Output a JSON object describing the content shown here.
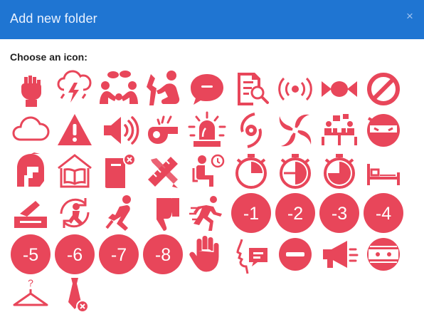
{
  "dialog": {
    "title": "Add new folder",
    "close_glyph": "×",
    "choose_label": "Choose an icon:"
  },
  "colors": {
    "header_bg": "#1f75d2",
    "icon_red": "#e8465a",
    "background": "#ffffff"
  },
  "icons": [
    {
      "name": "raised-fist-icon"
    },
    {
      "name": "thunderstorm-cloud-icon"
    },
    {
      "name": "people-talking-icon"
    },
    {
      "name": "person-kneeling-icon"
    },
    {
      "name": "speech-bubble-icon"
    },
    {
      "name": "document-search-icon"
    },
    {
      "name": "broadcast-signal-icon"
    },
    {
      "name": "candy-icon"
    },
    {
      "name": "no-entry-icon"
    },
    {
      "name": "cloud-icon"
    },
    {
      "name": "warning-triangle-icon"
    },
    {
      "name": "speaker-volume-icon"
    },
    {
      "name": "whistle-icon"
    },
    {
      "name": "siren-light-icon"
    },
    {
      "name": "hurricane-icon"
    },
    {
      "name": "tornado-spiral-icon"
    },
    {
      "name": "meeting-table-icon"
    },
    {
      "name": "ninja-icon"
    },
    {
      "name": "spartan-helmet-icon"
    },
    {
      "name": "reading-house-icon"
    },
    {
      "name": "book-remove-icon"
    },
    {
      "name": "ruler-pencil-icon"
    },
    {
      "name": "waiting-room-icon"
    },
    {
      "name": "stopwatch-quarter-icon"
    },
    {
      "name": "stopwatch-half-icon"
    },
    {
      "name": "stopwatch-three-quarter-icon"
    },
    {
      "name": "bed-icon"
    },
    {
      "name": "ballot-box-icon"
    },
    {
      "name": "rotate-person-icon"
    },
    {
      "name": "thinking-person-icon"
    },
    {
      "name": "thumbs-down-icon"
    },
    {
      "name": "running-person-icon"
    },
    {
      "name": "minus-one-icon",
      "text": "-1"
    },
    {
      "name": "minus-two-icon",
      "text": "-2"
    },
    {
      "name": "minus-three-icon",
      "text": "-3"
    },
    {
      "name": "minus-four-icon",
      "text": "-4"
    },
    {
      "name": "minus-five-icon",
      "text": "-5"
    },
    {
      "name": "minus-six-icon",
      "text": "-6"
    },
    {
      "name": "minus-seven-icon",
      "text": "-7"
    },
    {
      "name": "minus-eight-icon",
      "text": "-8"
    },
    {
      "name": "raised-hand-icon"
    },
    {
      "name": "talking-head-icon"
    },
    {
      "name": "minus-circle-icon"
    },
    {
      "name": "megaphone-icon"
    },
    {
      "name": "mummy-face-icon"
    },
    {
      "name": "hanger-question-icon"
    },
    {
      "name": "tie-remove-icon"
    }
  ]
}
